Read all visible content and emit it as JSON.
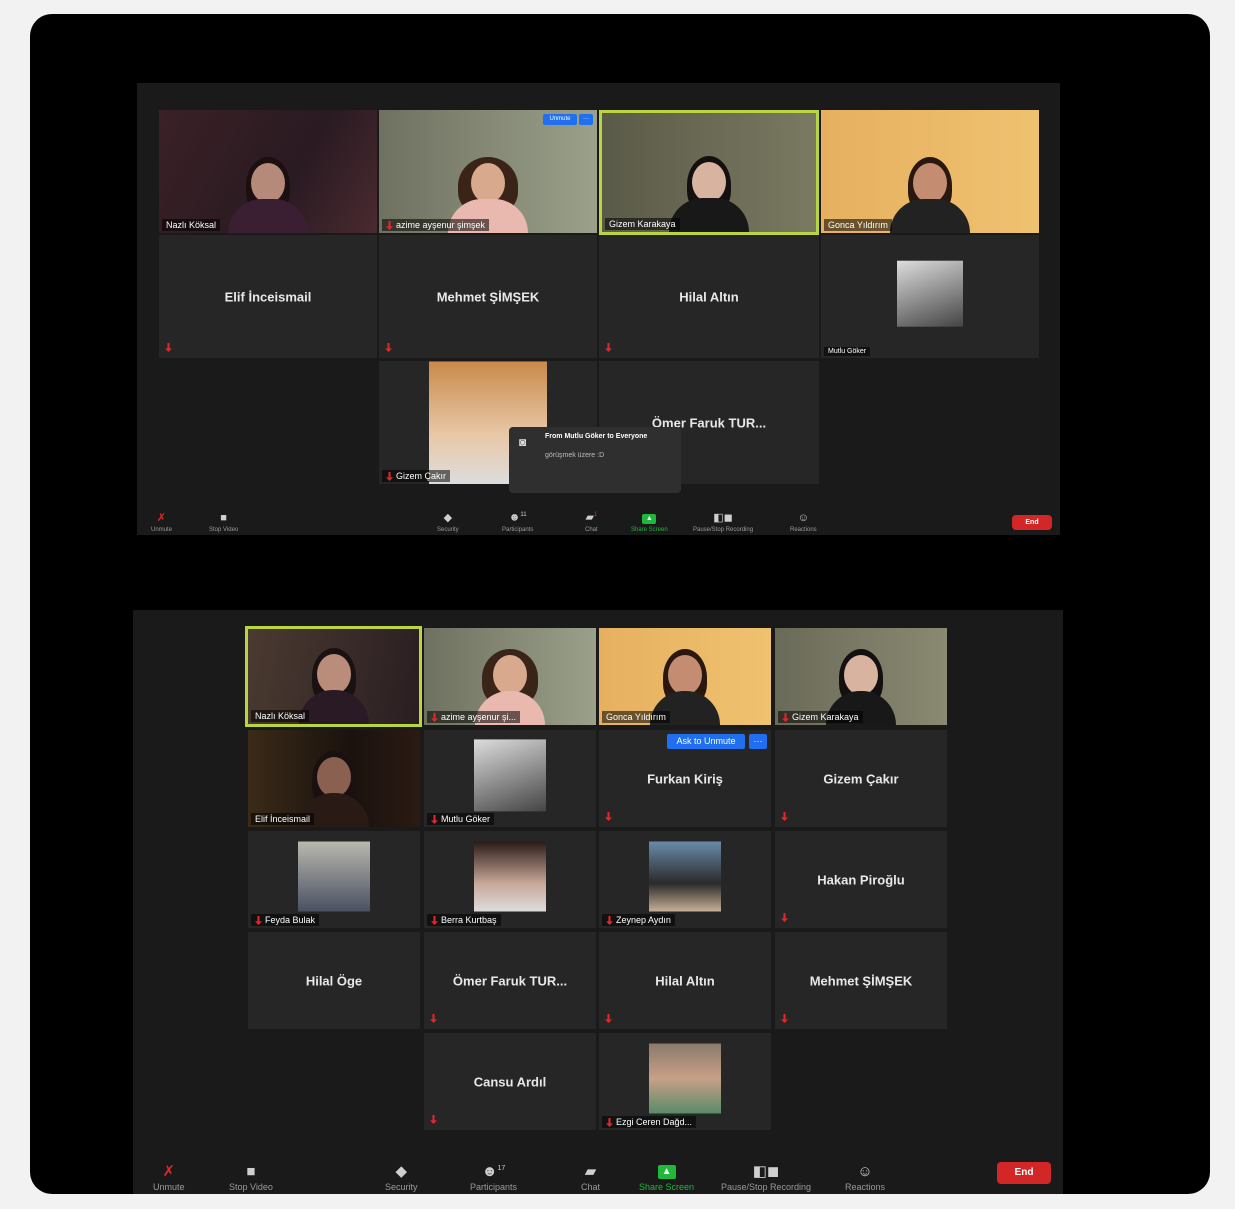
{
  "meeting1": {
    "tiles": [
      {
        "name": "Nazlı Köksal"
      },
      {
        "name": "azime ayşenur şimşek"
      },
      {
        "name": "Gizem Karakaya"
      },
      {
        "name": "Gonca Yıldırım"
      },
      {
        "name": "Elif İnceismail"
      },
      {
        "name": "Mehmet ŞİMŞEK"
      },
      {
        "name": "Hilal Altın"
      },
      {
        "name": "Mutlu Göker"
      },
      {
        "name": "Gizem Çakır"
      },
      {
        "name": "Ömer Faruk TUR..."
      }
    ],
    "unmute_btn": "Unmute",
    "chat_popup": {
      "from": "From Mutlu Göker to Everyone",
      "message": "görüşmek üzere :D"
    },
    "toolbar": {
      "unmute": "Unmute",
      "stop_video": "Stop Video",
      "security": "Security",
      "participants": "Participants",
      "participants_count": "11",
      "chat": "Chat",
      "chat_badge": "1",
      "share_screen": "Share Screen",
      "recording": "Pause/Stop Recording",
      "reactions": "Reactions",
      "end": "End"
    }
  },
  "meeting2": {
    "tiles": [
      {
        "name": "Nazlı Köksal"
      },
      {
        "name": "azime ayşenur şi..."
      },
      {
        "name": "Gonca Yıldırım"
      },
      {
        "name": "Gizem Karakaya"
      },
      {
        "name": "Elif İnceismail"
      },
      {
        "name": "Mutlu Göker"
      },
      {
        "name": "Furkan Kiriş"
      },
      {
        "name": "Gizem Çakır"
      },
      {
        "name": "Feyda Bulak"
      },
      {
        "name": "Berra Kurtbaş"
      },
      {
        "name": "Zeynep Aydın"
      },
      {
        "name": "Hakan Piroğlu"
      },
      {
        "name": "Hilal Öge"
      },
      {
        "name": "Ömer Faruk TUR..."
      },
      {
        "name": "Hilal Altın"
      },
      {
        "name": "Mehmet ŞİMŞEK"
      },
      {
        "name": "Cansu Ardıl"
      },
      {
        "name": "Ezgi Ceren Dağd..."
      }
    ],
    "ask_to_unmute": "Ask to Unmute",
    "toolbar": {
      "unmute": "Unmute",
      "stop_video": "Stop Video",
      "security": "Security",
      "participants": "Participants",
      "participants_count": "17",
      "chat": "Chat",
      "share_screen": "Share Screen",
      "recording": "Pause/Stop Recording",
      "reactions": "Reactions",
      "end": "End"
    }
  },
  "colors": {
    "active_border": "#b9d640",
    "end": "#d32626",
    "share": "#1fb83a",
    "mute": "#e02828"
  }
}
